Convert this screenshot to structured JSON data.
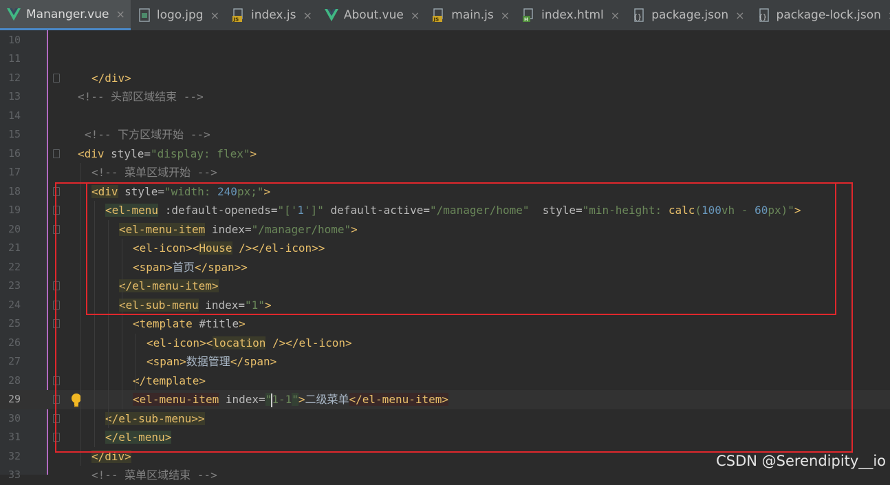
{
  "tabs": [
    {
      "label": "Mananger.vue",
      "icon": "vue-icon",
      "active": true
    },
    {
      "label": "logo.jpg",
      "icon": "image-file-icon",
      "active": false
    },
    {
      "label": "index.js",
      "icon": "js-file-icon",
      "active": false
    },
    {
      "label": "About.vue",
      "icon": "vue-icon",
      "active": false
    },
    {
      "label": "main.js",
      "icon": "js-file-icon",
      "active": false
    },
    {
      "label": "index.html",
      "icon": "html-file-icon",
      "active": false
    },
    {
      "label": "package.json",
      "icon": "json-file-icon",
      "active": false
    },
    {
      "label": "package-lock.json",
      "icon": "json-file-icon",
      "active": false
    }
  ],
  "close_glyph": "×",
  "gutter": {
    "line_numbers": [
      "10",
      "11",
      "12",
      "13",
      "14",
      "15",
      "16",
      "17",
      "18",
      "19",
      "20",
      "21",
      "22",
      "23",
      "24",
      "25",
      "26",
      "27",
      "28",
      "29",
      "30",
      "31",
      "32",
      "33"
    ],
    "current_line": "29"
  },
  "code": {
    "l12_close": "</div>",
    "l13_comment": "<!-- 头部区域结束 -->",
    "l15_comment": "<!-- 下方区域开始 -->",
    "l16_tag": "<div",
    "l16_attr": " style=",
    "l16_q1": "\"",
    "l16_val": "display: flex",
    "l16_q2": "\"",
    "l16_end": ">",
    "l17_comment": "<!-- 菜单区域开始 -->",
    "l18_tag": "<div",
    "l18_attr": " style=",
    "l18_val1": "\"width: ",
    "l18_num": "240",
    "l18_val2": "px;\"",
    "l18_end": ">",
    "l19_tag": "<el-menu",
    "l19_attr1": " :default-openeds=",
    "l19_val1a": "\"['",
    "l19_num1": "1",
    "l19_val1b": "']\"",
    "l19_attr2": " default-active=",
    "l19_val2": "\"/manager/home\"",
    "l19_attr3": "  style=",
    "l19_val3a": "\"min-height: ",
    "l19_fn": "calc",
    "l19_val3b": "(",
    "l19_num2": "100",
    "l19_val3c": "vh - ",
    "l19_num3": "60",
    "l19_val3d": "px)\"",
    "l19_end": ">",
    "l20_tag": "<el-menu-item",
    "l20_attr": " index=",
    "l20_val": "\"/manager/home\"",
    "l20_end": ">",
    "l21_a": "<el-icon><",
    "l21_comp": "House",
    "l21_b": " /></el-icon>>",
    "l22_a": "<span>",
    "l22_text": "首页",
    "l22_b": "</span>>",
    "l23": "</el-menu-item>",
    "l24_tag": "<el-sub-menu",
    "l24_attr": " index=",
    "l24_val": "\"1\"",
    "l24_end": ">",
    "l25_tag": "<template",
    "l25_attr": " #title",
    "l25_end": ">",
    "l26_a": "<el-icon><",
    "l26_comp": "location",
    "l26_b": " /></el-icon>",
    "l27_a": "<span>",
    "l27_text": "数据管理",
    "l27_b": "</span>",
    "l28": "</template>",
    "l29_tag": "<el-menu-item",
    "l29_attr": " index=",
    "l29_q1": "\"",
    "l29_val_a": "1",
    "l29_val_b": "-1",
    "l29_q2": "\"",
    "l29_gt": ">",
    "l29_text": "二级菜单",
    "l29_close": "</el-menu-item>",
    "l30": "</el-sub-menu>>",
    "l31": "</el-menu>",
    "l32": "</div>",
    "l33_comment": "<!-- 菜单区域结束 -->"
  },
  "watermark": "CSDN @Serendipity__io",
  "colors": {
    "annotation_box": "#e0272c",
    "tag": "#e8bf6a",
    "string": "#6a8759",
    "number": "#6897bb",
    "comment": "#808080"
  }
}
